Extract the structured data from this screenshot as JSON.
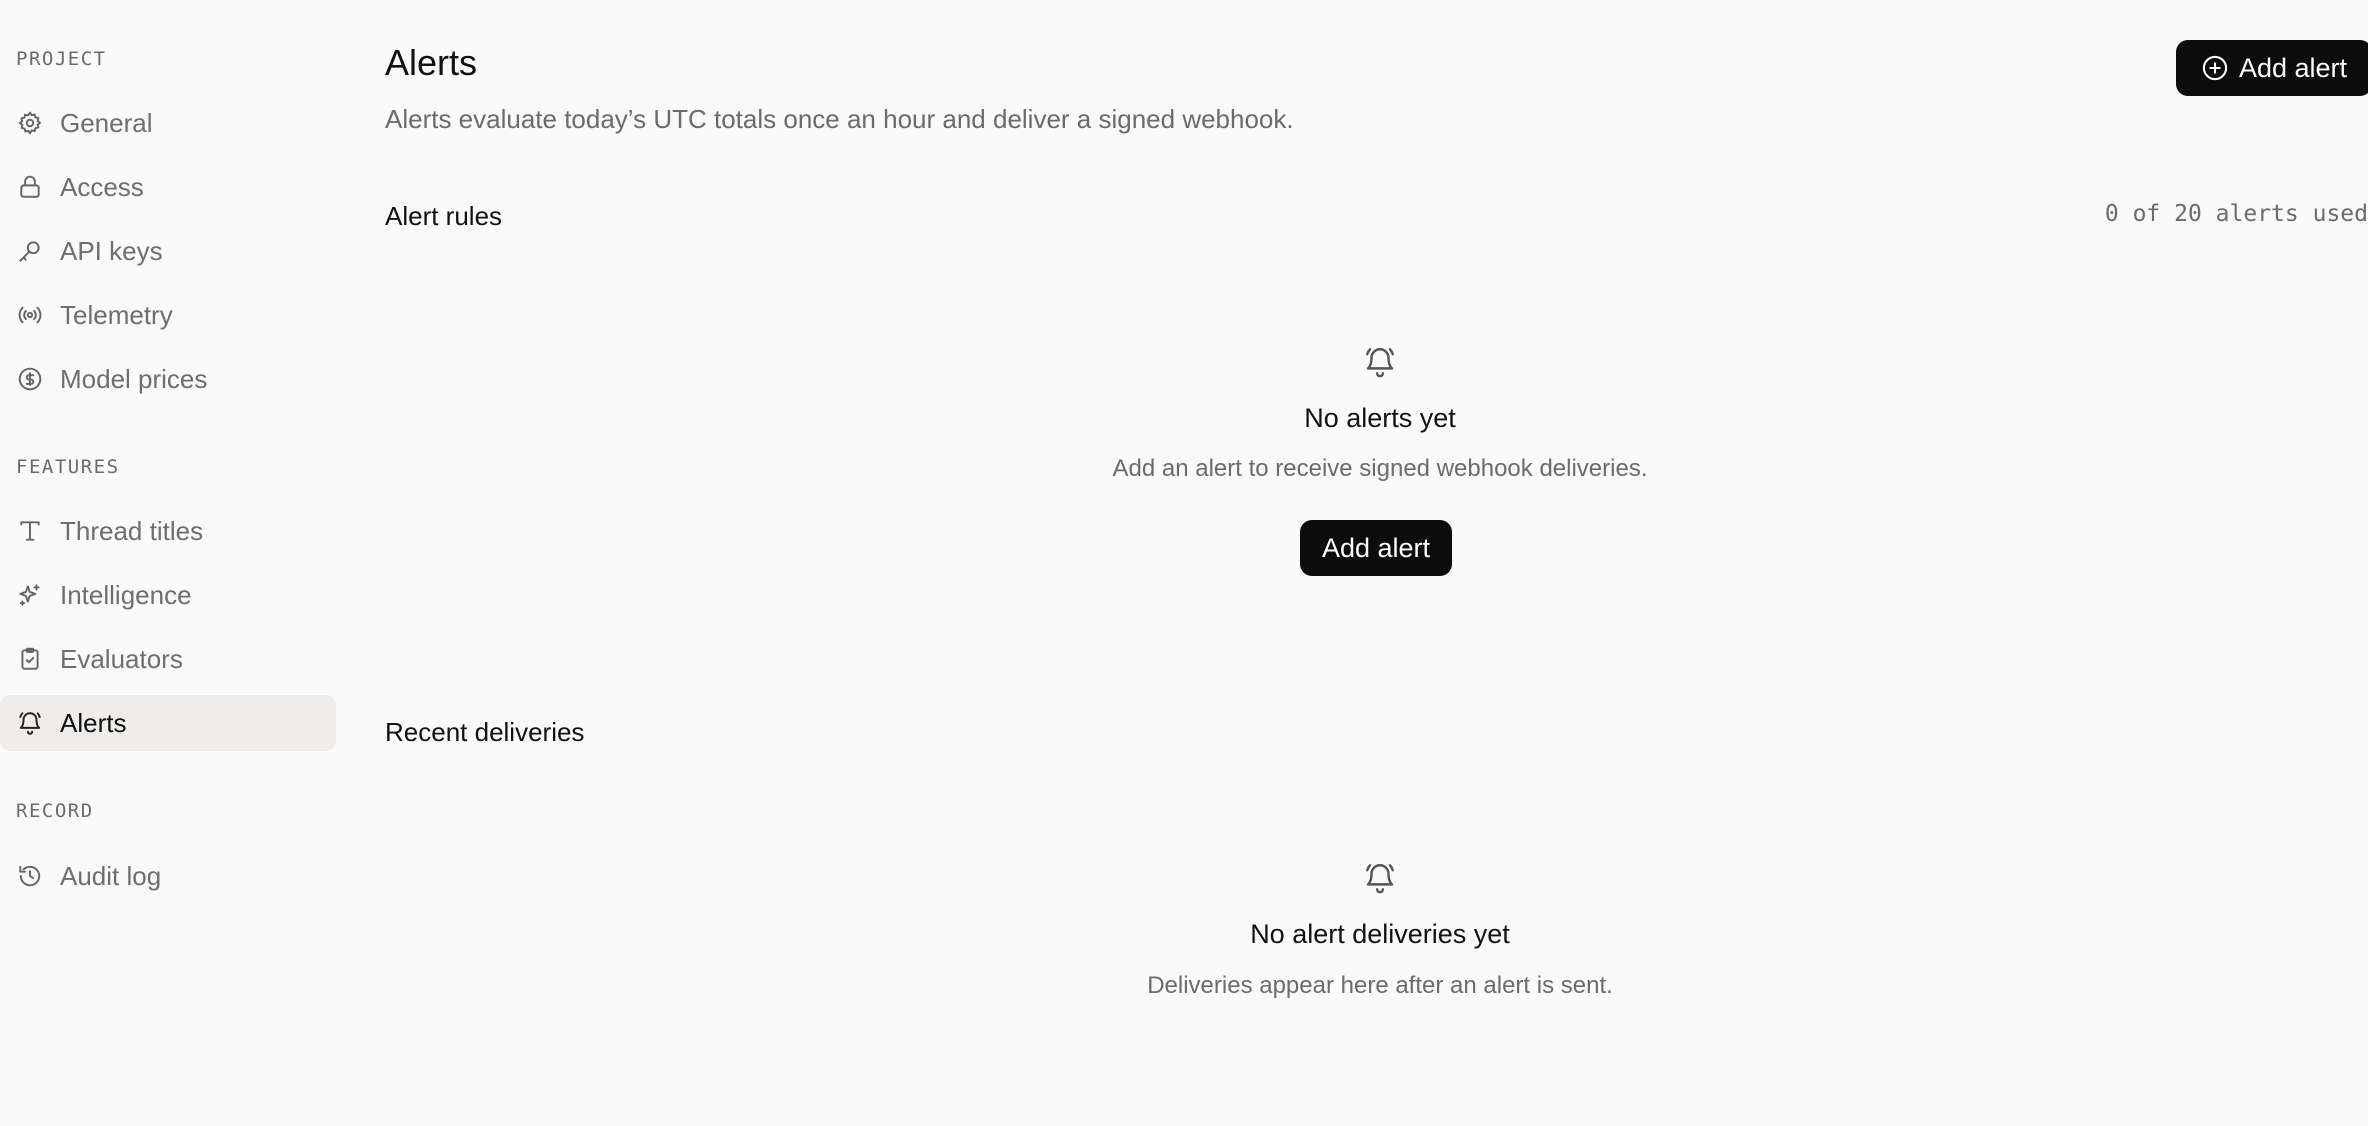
{
  "sidebar": {
    "sections": [
      {
        "label": "PROJECT",
        "items": [
          {
            "label": "General",
            "icon": "gear-icon"
          },
          {
            "label": "Access",
            "icon": "lock-icon"
          },
          {
            "label": "API keys",
            "icon": "key-icon"
          },
          {
            "label": "Telemetry",
            "icon": "broadcast-icon"
          },
          {
            "label": "Model prices",
            "icon": "dollar-circle-icon"
          }
        ]
      },
      {
        "label": "FEATURES",
        "items": [
          {
            "label": "Thread titles",
            "icon": "text-icon"
          },
          {
            "label": "Intelligence",
            "icon": "sparkles-icon"
          },
          {
            "label": "Evaluators",
            "icon": "clipboard-check-icon"
          },
          {
            "label": "Alerts",
            "icon": "bell-icon",
            "active": true
          }
        ]
      },
      {
        "label": "RECORD",
        "items": [
          {
            "label": "Audit log",
            "icon": "history-icon"
          }
        ]
      }
    ]
  },
  "header": {
    "title": "Alerts",
    "subtitle": "Alerts evaluate today’s UTC totals once an hour and deliver a signed webhook.",
    "add_button_label": "Add alert"
  },
  "alert_rules": {
    "heading": "Alert rules",
    "quota": "0 of 20 alerts used",
    "empty_title": "No alerts yet",
    "empty_description": "Add an alert to receive signed webhook deliveries.",
    "empty_button_label": "Add alert"
  },
  "recent_deliveries": {
    "heading": "Recent deliveries",
    "empty_title": "No alert deliveries yet",
    "empty_description": "Deliveries appear here after an alert is sent."
  },
  "colors": {
    "background": "#fafafa",
    "active_item_bg": "#eeedeb",
    "button_bg": "#0c0c0c",
    "muted_text": "#6b6b6b"
  }
}
